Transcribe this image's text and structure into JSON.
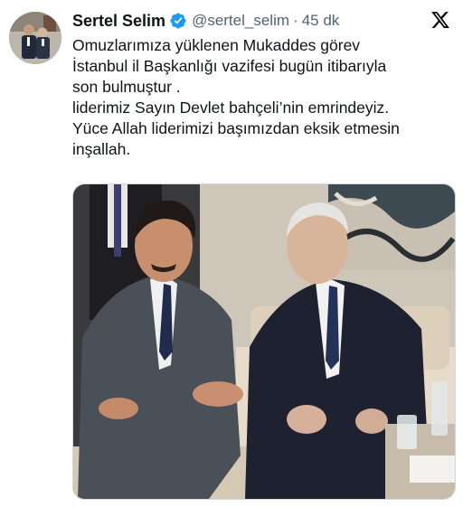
{
  "author": {
    "display_name": "Sertel Selim",
    "handle": "@sertel_selim",
    "separator": "·",
    "timestamp": "45 dk",
    "verified_color": "#1d9bf0"
  },
  "tweet": {
    "lines": [
      "Omuzlarımıza yüklenen Mukaddes görev",
      "İstanbul il Başkanlığı vazifesi bugün itibarıyla",
      "son bulmuştur .",
      "liderimiz Sayın Devlet bahçeli’nin emrindeyiz.",
      "Yüce Allah liderimizi başımızdan eksik etmesin",
      "inşallah."
    ]
  },
  "icons": {
    "verified": "verified-badge-icon",
    "platform": "x-logo-icon"
  },
  "colors": {
    "text_primary": "#0f1419",
    "text_secondary": "#536471",
    "brand": "#000000"
  }
}
